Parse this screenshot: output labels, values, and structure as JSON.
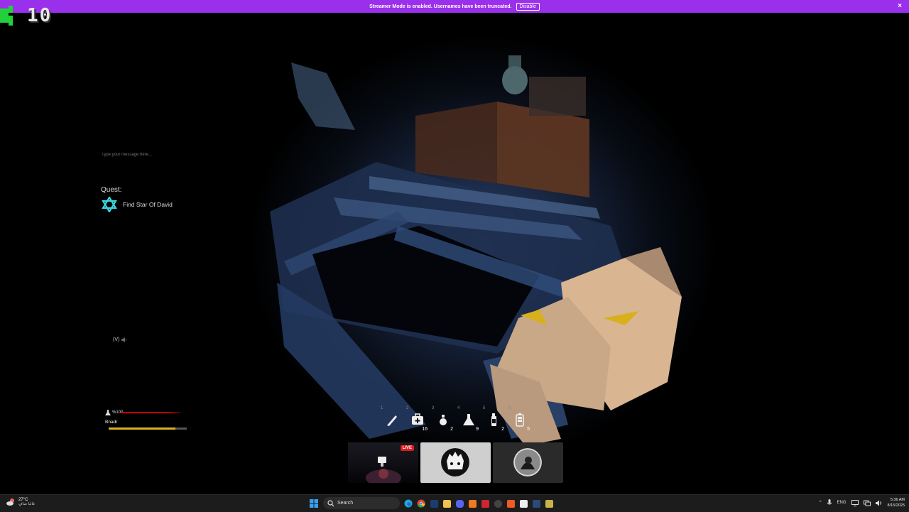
{
  "banner": {
    "message": "Streamer Mode is enabled. Usernames have been truncated.",
    "disable_label": "Disable",
    "close_glyph": "×",
    "color": "#9b30ec"
  },
  "hud": {
    "counter": "10",
    "chat_placeholder": "Type your message here...",
    "quest_label": "Quest:",
    "quest_item": "Find Star Of David",
    "quest_icon": "star-of-david-icon",
    "voice_label": "(V)",
    "player": {
      "health_text": "%100",
      "name": "Bnadr",
      "health_fraction": 1.0,
      "stamina_fraction": 0.85
    },
    "hotbar": [
      {
        "key": "1",
        "icon": "knife-icon",
        "count": ""
      },
      {
        "key": "2",
        "icon": "medkit-icon",
        "count": "16"
      },
      {
        "key": "3",
        "icon": "potion-icon",
        "count": "2"
      },
      {
        "key": "4",
        "icon": "flask-icon",
        "count": "9"
      },
      {
        "key": "5",
        "icon": "spray-bottle-icon",
        "count": "2"
      },
      {
        "key": "6",
        "icon": "battery-icon",
        "count": "5"
      }
    ]
  },
  "webcams": {
    "live_label": "LIVE"
  },
  "taskbar": {
    "temperature": "27°C",
    "weather_text": "غالبا صافٍ",
    "search_label": "Search",
    "language": "ENG",
    "time": "5:36 AM",
    "date": "8/15/2025"
  }
}
